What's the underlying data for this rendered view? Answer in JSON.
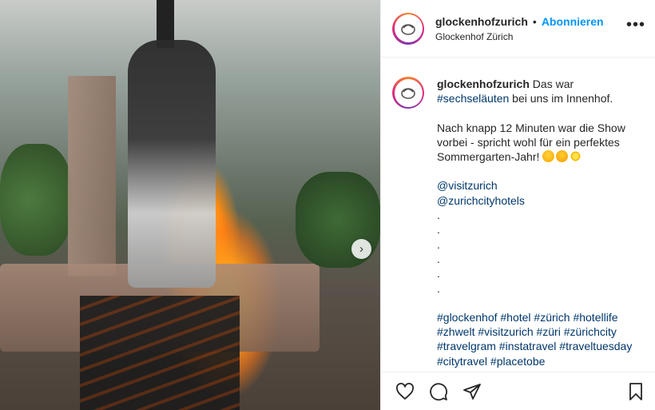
{
  "header": {
    "username": "glockenhofzurich",
    "separator": "•",
    "follow_label": "Abonnieren",
    "location": "Glockenhof Zürich",
    "more_label": "•••"
  },
  "caption": {
    "username": "glockenhofzurich",
    "line1_text": " Das war ",
    "line1_tag": "#sechseläuten",
    "line1_rest": " bei uns im Innenhof.",
    "para2": "Nach knapp 12 Minuten war die Show vorbei - spricht wohl für ein perfektes Sommergarten-Jahr! ",
    "mention1": "@visitzurich",
    "mention2": "@zurichcityhotels",
    "dots": [
      ".",
      ".",
      ".",
      ".",
      ".",
      "."
    ],
    "hashtags": "#glockenhof #hotel #zürich #hotellife #zhwelt #visitzurich #züri #zürichcity #travelgram #instatravel #traveltuesday #citytravel #placetobe"
  },
  "icons": {
    "emoji1": "smiling-face-with-hearts-emoji",
    "emoji2": "heart-eyes-emoji",
    "emoji3": "sun-emoji",
    "next": "chevron-right-icon",
    "like": "heart-icon",
    "comment": "comment-icon",
    "share": "send-icon",
    "save": "bookmark-icon"
  },
  "colors": {
    "accent": "#0095f6",
    "tag": "#00376b",
    "text": "#262626"
  }
}
